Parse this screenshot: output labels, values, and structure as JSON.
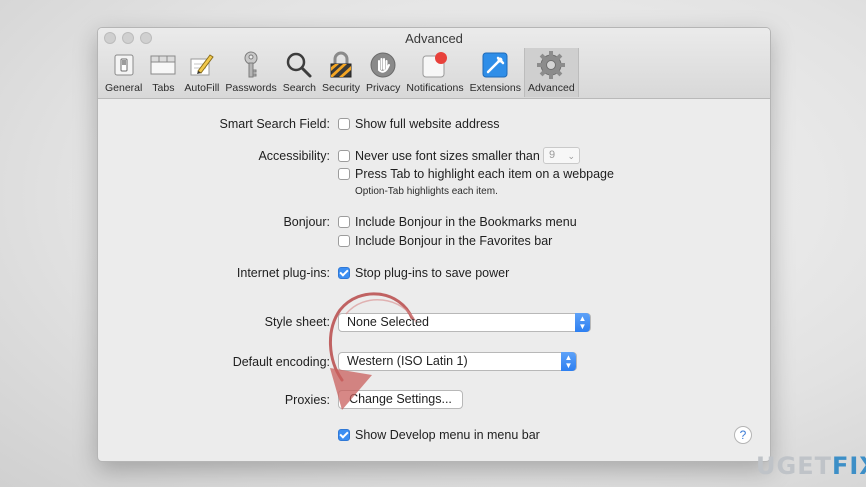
{
  "window": {
    "title": "Advanced"
  },
  "toolbar": {
    "items": [
      {
        "label": "General",
        "icon": "switch-icon"
      },
      {
        "label": "Tabs",
        "icon": "tabs-icon"
      },
      {
        "label": "AutoFill",
        "icon": "pencil-icon"
      },
      {
        "label": "Passwords",
        "icon": "key-icon"
      },
      {
        "label": "Search",
        "icon": "magnifier-icon"
      },
      {
        "label": "Security",
        "icon": "lock-icon"
      },
      {
        "label": "Privacy",
        "icon": "hand-icon"
      },
      {
        "label": "Notifications",
        "icon": "notification-badge-icon"
      },
      {
        "label": "Extensions",
        "icon": "puzzle-icon"
      },
      {
        "label": "Advanced",
        "icon": "gear-icon",
        "selected": true
      }
    ]
  },
  "settings": {
    "smart_search": {
      "label": "Smart Search Field:",
      "option": "Show full website address",
      "checked": false
    },
    "accessibility": {
      "label": "Accessibility:",
      "option1": "Never use font sizes smaller than",
      "font_size_value": "9",
      "option2": "Press Tab to highlight each item on a webpage",
      "note": "Option-Tab highlights each item."
    },
    "bonjour": {
      "label": "Bonjour:",
      "option1": "Include Bonjour in the Bookmarks menu",
      "option2": "Include Bonjour in the Favorites bar"
    },
    "plugins": {
      "label": "Internet plug-ins:",
      "option": "Stop plug-ins to save power",
      "checked": true
    },
    "stylesheet": {
      "label": "Style sheet:",
      "value": "None Selected"
    },
    "encoding": {
      "label": "Default encoding:",
      "value": "Western (ISO Latin 1)"
    },
    "proxies": {
      "label": "Proxies:",
      "button": "Change Settings..."
    },
    "develop": {
      "option": "Show Develop menu in menu bar",
      "checked": true
    }
  },
  "help": {
    "glyph": "?"
  },
  "watermark": {
    "part1": "UG",
    "part2": "ET",
    "part3": "FIX"
  },
  "colors": {
    "accent": "#3b8ef2",
    "annotation_arrow": "#b84a4a",
    "notification_dot": "#e8413b"
  }
}
